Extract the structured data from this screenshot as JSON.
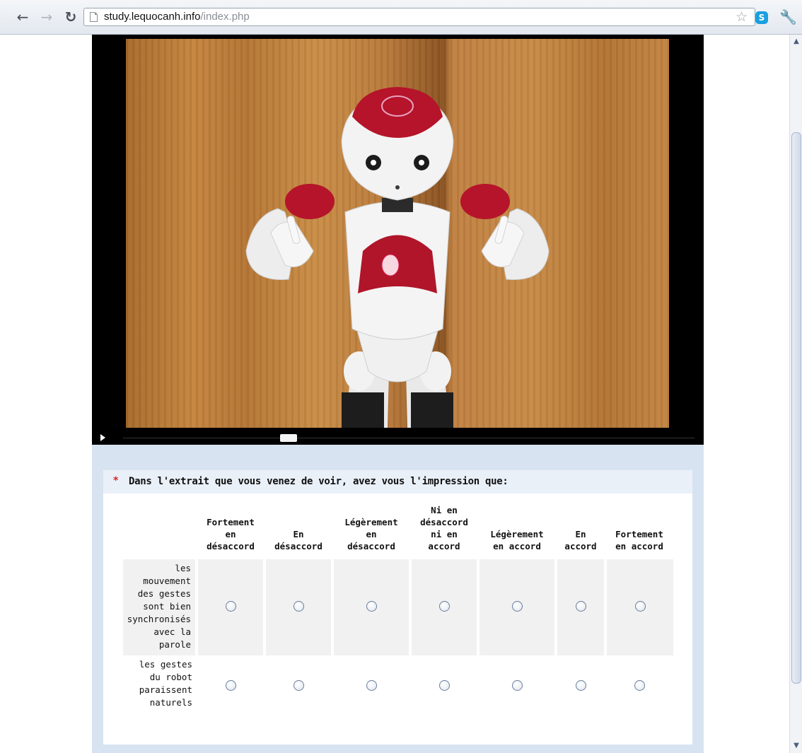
{
  "browser": {
    "url_host": "study.lequocanh.info",
    "url_path": "/index.php",
    "skype_label": "S"
  },
  "icons": {
    "back": "back-arrow-icon",
    "forward": "forward-arrow-icon",
    "reload": "reload-icon",
    "page": "page-icon",
    "bookmark": "star-icon",
    "extension": "skype-icon",
    "menu": "wrench-icon"
  },
  "video": {
    "progress": 0.29
  },
  "question": {
    "required_marker": "*",
    "text": "Dans l'extrait que vous venez de voir, avez vous l'impression que:",
    "columns": [
      [
        "Fortement",
        "en",
        "désaccord"
      ],
      [
        "En",
        "désaccord"
      ],
      [
        "Légèrement",
        "en",
        "désaccord"
      ],
      [
        "Ni en",
        "désaccord",
        "ni en",
        "accord"
      ],
      [
        "Légèrement",
        "en accord"
      ],
      [
        "En",
        "accord"
      ],
      [
        "Fortement",
        "en accord"
      ]
    ],
    "rows": [
      [
        "les",
        "mouvement",
        "des gestes",
        "sont bien",
        "synchronisés",
        "avec la",
        "parole"
      ],
      [
        "les gestes",
        "du robot",
        "paraissent",
        "naturels"
      ]
    ]
  },
  "colors": {
    "page_background": "#d8e3f1",
    "required": "#dd2222",
    "video_background": "#000000"
  }
}
